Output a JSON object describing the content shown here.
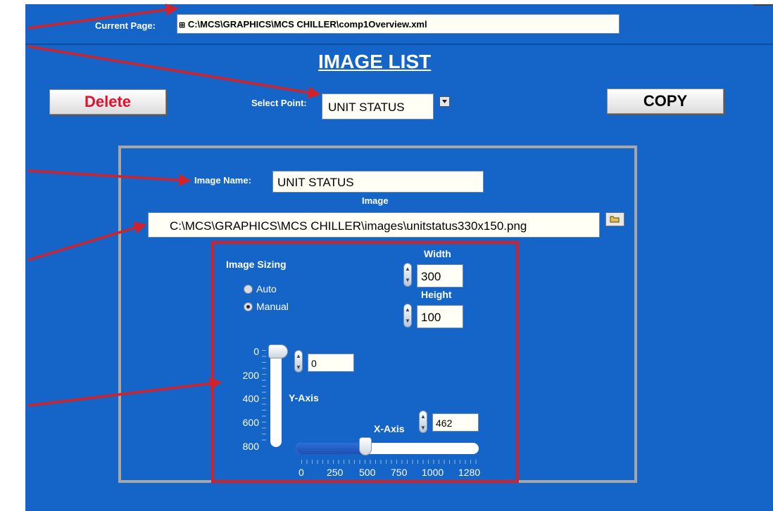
{
  "current_page": {
    "label": "Current Page:",
    "icon": "tree-icon",
    "value": "C:\\MCS\\GRAPHICS\\MCS CHILLER\\comp1Overview.xml"
  },
  "title": "IMAGE LIST",
  "buttons": {
    "delete": "Delete",
    "copy": "COPY"
  },
  "select_point": {
    "label": "Select Point:",
    "value": "UNIT STATUS"
  },
  "image_name": {
    "label": "Image Name:",
    "value": "UNIT STATUS"
  },
  "image": {
    "label": "Image",
    "path": "C:\\MCS\\GRAPHICS\\MCS CHILLER\\images\\unitstatus330x150.png"
  },
  "sizing": {
    "label": "Image Sizing",
    "options": [
      "Auto",
      "Manual"
    ],
    "selected": "Manual",
    "width_label": "Width",
    "width": "300",
    "height_label": "Height",
    "height": "100"
  },
  "y_axis": {
    "label": "Y-Axis",
    "value": "0",
    "ticks": [
      "0",
      "200",
      "400",
      "600",
      "800"
    ],
    "max": 800,
    "slider_value": 0
  },
  "x_axis": {
    "label": "X-Axis",
    "value": "462",
    "ticks": [
      "0",
      "250",
      "500",
      "750",
      "1000",
      "1280"
    ],
    "max": 1280,
    "slider_value": 462
  },
  "colors": {
    "panel": "#1565c8",
    "annotation_red": "#d32127",
    "delete_text": "#e0102f"
  }
}
